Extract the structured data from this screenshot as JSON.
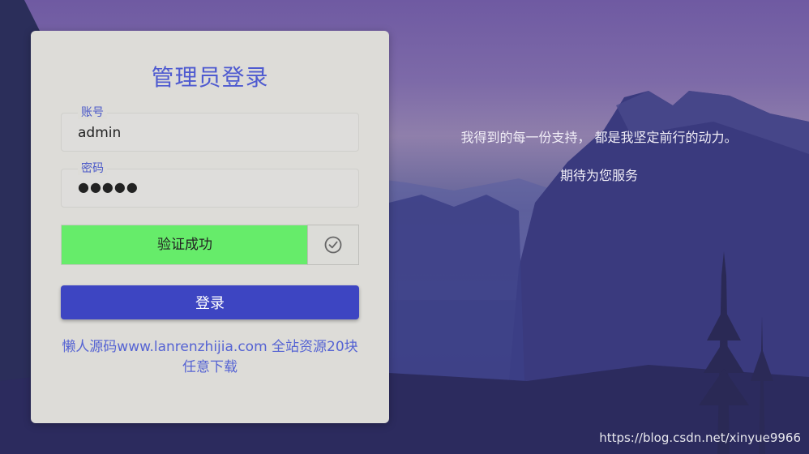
{
  "login": {
    "title": "管理员登录",
    "account_label": "账号",
    "account_value": "admin",
    "password_label": "密码",
    "password_value": "●●●●●",
    "verify_text": "验证成功",
    "login_button": "登录",
    "footer_link": "懒人源码www.lanrenzhijia.com 全站资源20块任意下载"
  },
  "slogan": {
    "line1": "我得到的每一份支持， 都是我坚定前行的动力。",
    "line2": "期待为您服务"
  },
  "watermark": "https://blog.csdn.net/xinyue9966",
  "colors": {
    "accent": "#4e5ad0",
    "button": "#3d45c2",
    "verify_success": "#66ec6a",
    "card": "#dddcd8"
  },
  "icons": {
    "verify_handle": "check-circle-icon"
  }
}
